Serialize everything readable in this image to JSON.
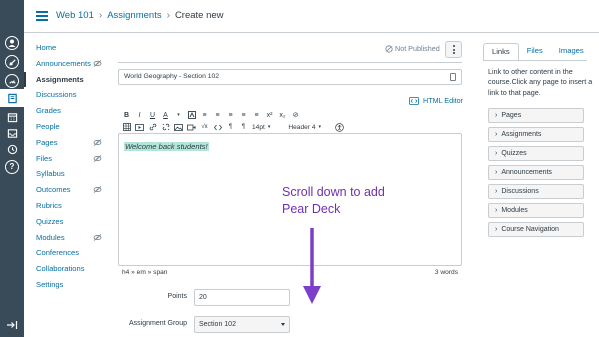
{
  "breadcrumb": {
    "course": "Web 101",
    "section": "Assignments",
    "current": "Create new",
    "separator": "›"
  },
  "global_nav": {
    "icons": [
      "user-icon",
      "admin-shield-icon",
      "dashboard-icon",
      "courses-icon",
      "calendar-icon",
      "inbox-icon",
      "history-icon",
      "help-icon",
      "collapse-nav-icon"
    ]
  },
  "course_nav": {
    "items": [
      {
        "label": "Home",
        "hidden": false,
        "active": false
      },
      {
        "label": "Announcements",
        "hidden": true,
        "active": false
      },
      {
        "label": "Assignments",
        "hidden": false,
        "active": true
      },
      {
        "label": "Discussions",
        "hidden": false,
        "active": false
      },
      {
        "label": "Grades",
        "hidden": false,
        "active": false
      },
      {
        "label": "People",
        "hidden": false,
        "active": false
      },
      {
        "label": "Pages",
        "hidden": true,
        "active": false
      },
      {
        "label": "Files",
        "hidden": true,
        "active": false
      },
      {
        "label": "Syllabus",
        "hidden": false,
        "active": false
      },
      {
        "label": "Outcomes",
        "hidden": true,
        "active": false
      },
      {
        "label": "Rubrics",
        "hidden": false,
        "active": false
      },
      {
        "label": "Quizzes",
        "hidden": false,
        "active": false
      },
      {
        "label": "Modules",
        "hidden": true,
        "active": false
      },
      {
        "label": "Conferences",
        "hidden": false,
        "active": false
      },
      {
        "label": "Collaborations",
        "hidden": false,
        "active": false
      },
      {
        "label": "Settings",
        "hidden": false,
        "active": false
      }
    ]
  },
  "main": {
    "publish_status": "Not Published",
    "title_value": "World Geography - Section 102",
    "html_editor_label": "HTML Editor",
    "toolbar": {
      "row1": [
        "B",
        "I",
        "U",
        "A",
        "▾",
        "≡",
        "≡",
        "≡",
        "≡",
        "≡",
        "x²",
        "x₂",
        "⊘"
      ],
      "font_size": "14pt",
      "block_format": "Header 4"
    },
    "editor_content": "Welcome back students!",
    "status_path": "h4 » em » span",
    "word_count": "3 words",
    "annotation": "Scroll down to add Pear Deck",
    "points_label": "Points",
    "points_value": "20",
    "group_label": "Assignment Group",
    "group_value": "Section 102"
  },
  "right_sidebar": {
    "tabs": [
      "Links",
      "Files",
      "Images"
    ],
    "selected_tab": "Links",
    "description": "Link to other content in the course.Click any page to insert a link to that page.",
    "accordions": [
      "Pages",
      "Assignments",
      "Quizzes",
      "Announcements",
      "Discussions",
      "Modules",
      "Course Navigation"
    ]
  },
  "colors": {
    "global_nav_bg": "#394b58",
    "link": "#0770a3",
    "text": "#2d3b45",
    "highlight": "#b3e6d9",
    "annotation": "#7030b0"
  }
}
